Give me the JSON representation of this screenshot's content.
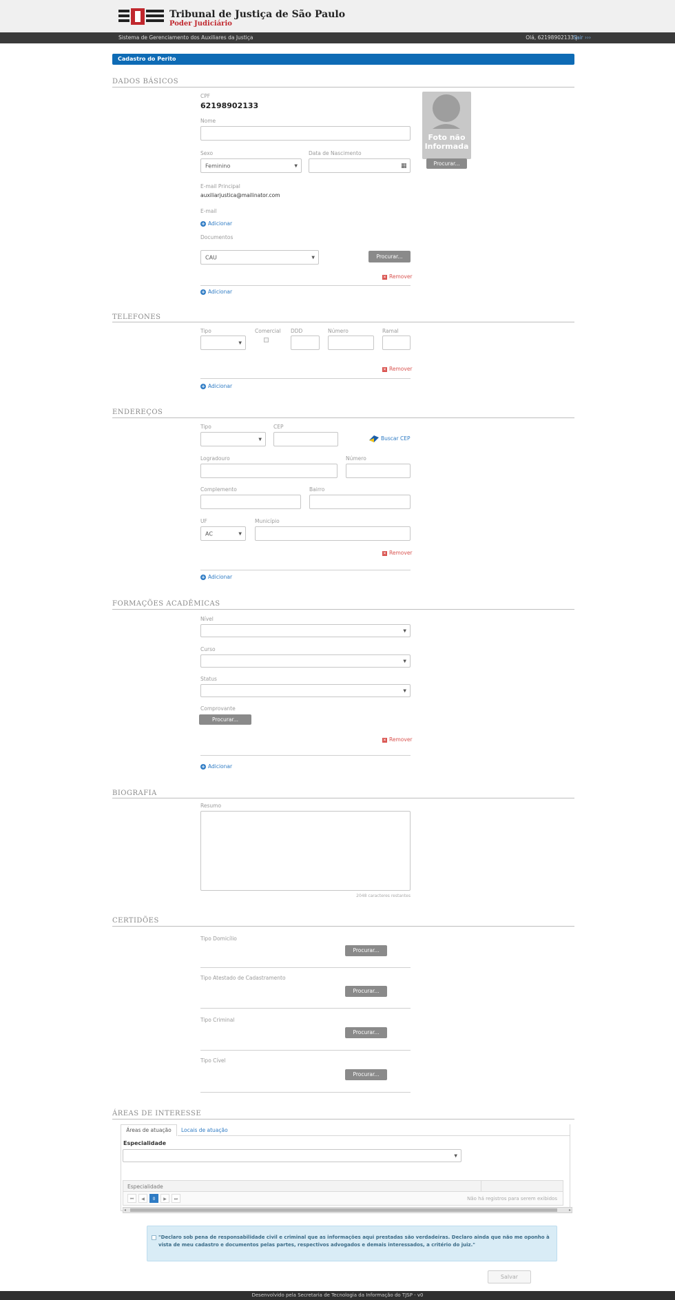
{
  "header": {
    "court_name": "Tribunal de Justiça de São Paulo",
    "court_subtitle": "Poder Judiciário",
    "system_name": "Sistema de Gerenciamento dos Auxiliares da Justiça",
    "greeting": "Olá, 62198902133 |",
    "logout_label": "Sair ›››"
  },
  "page": {
    "title": "Cadastro do Perito"
  },
  "dados_basicos": {
    "section_title": "DADOS BÁSICOS",
    "cpf_label": "CPF",
    "cpf_value": "62198902133",
    "nome_label": "Nome",
    "nome_value": "",
    "sexo_label": "Sexo",
    "sexo_value": "Feminino",
    "nascimento_label": "Data de Nascimento",
    "nascimento_value": "",
    "email_principal_label": "E-mail Principal",
    "email_principal_value": "auxiliarjustica@mailinator.com",
    "email_label": "E-mail",
    "add_email_label": "Adicionar",
    "documentos_label": "Documentos",
    "documento_value": "CAU",
    "procurar_label": "Procurar...",
    "remover_label": "Remover",
    "add_doc_label": "Adicionar",
    "photo_text_1": "Foto não",
    "photo_text_2": "Informada",
    "photo_button": "Procurar..."
  },
  "telefones": {
    "section_title": "TELEFONES",
    "tipo_label": "Tipo",
    "comercial_label": "Comercial",
    "ddd_label": "DDD",
    "numero_label": "Número",
    "ramal_label": "Ramal",
    "remover_label": "Remover",
    "add_label": "Adicionar"
  },
  "enderecos": {
    "section_title": "ENDEREÇOS",
    "tipo_label": "Tipo",
    "cep_label": "CEP",
    "buscar_cep_label": "Buscar CEP",
    "logradouro_label": "Logradouro",
    "numero_label": "Número",
    "complemento_label": "Complemento",
    "bairro_label": "Bairro",
    "uf_label": "UF",
    "uf_value": "AC",
    "municipio_label": "Município",
    "remover_label": "Remover",
    "add_label": "Adicionar"
  },
  "formacoes": {
    "section_title": "FORMAÇÕES ACADÊMICAS",
    "nivel_label": "Nível",
    "curso_label": "Curso",
    "status_label": "Status",
    "comprovante_label": "Comprovante",
    "procurar_label": "Procurar...",
    "remover_label": "Remover",
    "add_label": "Adicionar"
  },
  "biografia": {
    "section_title": "BIOGRAFIA",
    "resumo_label": "Resumo",
    "counter": "2048 caracteres restantes"
  },
  "certidoes": {
    "section_title": "CERTIDÕES",
    "items": [
      {
        "label": "Tipo Domicílio",
        "button": "Procurar..."
      },
      {
        "label": "Tipo Atestado de Cadastramento",
        "button": "Procurar..."
      },
      {
        "label": "Tipo Criminal",
        "button": "Procurar..."
      },
      {
        "label": "Tipo Cível",
        "button": "Procurar..."
      }
    ]
  },
  "areas": {
    "section_title": "ÁREAS DE INTERESSE",
    "tab_atuacao": "Áreas de atuação",
    "tab_locais": "Locais de atuação",
    "especialidade_label": "Especialidade",
    "grid_column": "Especialidade",
    "page_number": "0",
    "empty_message": "Não há registros para serem exibidos"
  },
  "declaration": {
    "text": "\"Declaro sob pena de responsabilidade civil e criminal que as informações aqui prestadas são verdadeiras. Declaro ainda que não me oponho à vista de meu cadastro e documentos pelas partes, respectivos advogados e demais interessados, a critério do juiz.\""
  },
  "actions": {
    "save_label": "Salvar"
  },
  "footer": {
    "text": "Desenvolvido pela Secretaria de Tecnologia da Informação do TJSP - v0"
  },
  "colors": {
    "primary": "#0e6bb5",
    "danger": "#d9534f",
    "link": "#2e7bc4"
  }
}
